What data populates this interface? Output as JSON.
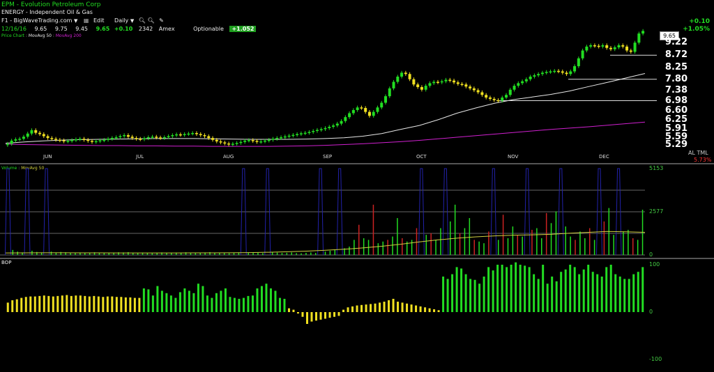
{
  "header": {
    "title": "EPM - Evolution Petroleum Corp",
    "sector": "ENERGY - Independent Oil & Gas",
    "window_label": "F1 - BigWaveTrading.com",
    "menu_edit": "Edit",
    "period": "Daily",
    "quote": {
      "date": "12/16/16",
      "open": "9.65",
      "high": "9.75",
      "low": "9.45",
      "close": "9.65",
      "change": "+0.10",
      "volume": "2342",
      "exchange": "Amex"
    },
    "optionable": "Optionable",
    "optionable_value": "+1.052",
    "change_abs": "+0.10",
    "change_pct": "+1.05%",
    "legend_price": "Price Chart",
    "legend_ma50": "MovAvg 50",
    "legend_ma200": "MovAvg 200"
  },
  "colors": {
    "up": "#22dd22",
    "down": "#f0e020",
    "ma50": "#e8e8e8",
    "ma200": "#d020d0",
    "volume_ma": "#d0d040",
    "volume_spike": "#2222aa",
    "red_volume": "#cc2222",
    "grid": "#666666"
  },
  "price_panel": {
    "last_price_tag": "9.65",
    "axis_labels": [
      "9.22",
      "8.72",
      "8.25",
      "7.80",
      "7.38",
      "6.98",
      "6.60",
      "6.25",
      "5.91",
      "5.59",
      "5.29"
    ],
    "months": [
      "JUN",
      "JUL",
      "AUG",
      "SEP",
      "OCT",
      "NOV",
      "DEC"
    ],
    "corner_tools": "AL TML",
    "corner_pct": "5.73%"
  },
  "volume_panel": {
    "title": "Volume",
    "ma_label": "MovAvg 50",
    "axis_labels": [
      "5153",
      "2577",
      "0"
    ]
  },
  "bop_panel": {
    "title": "BOP",
    "axis_labels": [
      "100",
      "0",
      "-100"
    ]
  },
  "chart_data": [
    {
      "type": "candlestick",
      "title": "EPM - Evolution Petroleum Corp",
      "x_months": [
        "JUN",
        "JUL",
        "AUG",
        "SEP",
        "OCT",
        "NOV",
        "DEC"
      ],
      "ylim": [
        5.1,
        9.5
      ],
      "y_ticks": [
        9.22,
        8.72,
        8.25,
        7.8,
        7.38,
        6.98,
        6.6,
        6.25,
        5.91,
        5.59,
        5.29
      ],
      "close": [
        5.33,
        5.45,
        5.5,
        5.52,
        5.6,
        5.72,
        5.85,
        5.75,
        5.7,
        5.62,
        5.55,
        5.52,
        5.48,
        5.46,
        5.42,
        5.44,
        5.47,
        5.5,
        5.52,
        5.48,
        5.44,
        5.4,
        5.43,
        5.46,
        5.48,
        5.52,
        5.55,
        5.58,
        5.62,
        5.66,
        5.6,
        5.55,
        5.52,
        5.5,
        5.54,
        5.58,
        5.6,
        5.57,
        5.55,
        5.58,
        5.62,
        5.66,
        5.69,
        5.67,
        5.7,
        5.72,
        5.74,
        5.7,
        5.66,
        5.62,
        5.55,
        5.48,
        5.42,
        5.38,
        5.34,
        5.3,
        5.33,
        5.36,
        5.4,
        5.45,
        5.47,
        5.44,
        5.4,
        5.42,
        5.45,
        5.48,
        5.52,
        5.55,
        5.58,
        5.61,
        5.64,
        5.67,
        5.7,
        5.73,
        5.75,
        5.78,
        5.82,
        5.86,
        5.89,
        5.93,
        5.98,
        6.03,
        6.1,
        6.2,
        6.35,
        6.5,
        6.62,
        6.72,
        6.7,
        6.55,
        6.4,
        6.55,
        6.72,
        6.9,
        7.15,
        7.45,
        7.7,
        7.9,
        8.05,
        8.0,
        7.8,
        7.6,
        7.5,
        7.4,
        7.55,
        7.65,
        7.7,
        7.68,
        7.72,
        7.78,
        7.75,
        7.68,
        7.62,
        7.6,
        7.52,
        7.45,
        7.38,
        7.3,
        7.2,
        7.1,
        7.05,
        7.0,
        6.98,
        7.1,
        7.2,
        7.4,
        7.55,
        7.65,
        7.72,
        7.8,
        7.9,
        7.95,
        8.0,
        8.05,
        8.08,
        8.1,
        8.12,
        8.1,
        8.05,
        8.0,
        8.1,
        8.3,
        8.6,
        8.9,
        9.05,
        9.1,
        9.08,
        9.05,
        9.1,
        9.0,
        8.95,
        9.02,
        9.1,
        9.05,
        8.9,
        8.85,
        9.2,
        9.55,
        9.65
      ]
    },
    {
      "type": "line",
      "name": "MovAvg 50",
      "values": [
        5.35,
        5.4,
        5.44,
        5.47,
        5.49,
        5.5,
        5.51,
        5.52,
        5.53,
        5.53,
        5.53,
        5.52,
        5.51,
        5.5,
        5.5,
        5.5,
        5.51,
        5.53,
        5.56,
        5.62,
        5.72,
        5.88,
        6.03,
        6.25,
        6.5,
        6.7,
        6.88,
        7.02,
        7.12,
        7.22,
        7.35,
        7.52,
        7.68,
        7.85,
        8.02
      ]
    },
    {
      "type": "line",
      "name": "MovAvg 200",
      "values": [
        5.32,
        5.3,
        5.29,
        5.28,
        5.27,
        5.26,
        5.26,
        5.25,
        5.25,
        5.24,
        5.24,
        5.23,
        5.23,
        5.23,
        5.23,
        5.24,
        5.25,
        5.27,
        5.3,
        5.33,
        5.37,
        5.41,
        5.46,
        5.52,
        5.58,
        5.64,
        5.7,
        5.76,
        5.82,
        5.88,
        5.93,
        5.98,
        6.04,
        6.1,
        6.16
      ]
    },
    {
      "type": "bar",
      "name": "Volume",
      "ylim": [
        0,
        5153
      ],
      "values": [
        5153,
        300,
        200,
        150,
        5153,
        250,
        180,
        150,
        5153,
        200,
        150,
        180,
        160,
        140,
        130,
        150,
        120,
        140,
        160,
        130,
        120,
        110,
        140,
        160,
        150,
        170,
        130,
        120,
        140,
        110,
        100,
        130,
        150,
        120,
        110,
        140,
        130,
        160,
        120,
        110,
        130,
        150,
        170,
        140,
        120,
        110,
        100,
        130,
        150,
        5153,
        140,
        120,
        130,
        110,
        5153,
        160,
        140,
        120,
        130,
        150,
        110,
        100,
        130,
        150,
        120,
        5153,
        200,
        250,
        300,
        5153,
        400,
        500,
        900,
        1800,
        1000,
        900,
        3000,
        700,
        800,
        900,
        1100,
        2200,
        1000,
        800,
        900,
        1600,
        5153,
        1200,
        1300,
        900,
        1600,
        5153,
        2000,
        3000,
        1300,
        1600,
        2200,
        900,
        800,
        700,
        1400,
        5153,
        900,
        2400,
        1000,
        1700,
        1200,
        1100,
        5153,
        1500,
        1600,
        1000,
        2500,
        1900,
        2600,
        5153,
        1700,
        1100,
        900,
        1400,
        1000,
        1600,
        900,
        5153,
        2000,
        2800,
        1200,
        5153,
        1400,
        1500,
        1000,
        900,
        2700
      ]
    },
    {
      "type": "bar",
      "name": "BOP",
      "ylim": [
        -100,
        100
      ],
      "values": [
        20,
        25,
        27,
        30,
        32,
        33,
        33,
        34,
        35,
        34,
        33,
        34,
        35,
        36,
        34,
        35,
        35,
        34,
        33,
        34,
        33,
        32,
        33,
        33,
        32,
        32,
        31,
        31,
        30,
        30,
        50,
        48,
        35,
        55,
        45,
        40,
        35,
        30,
        42,
        50,
        45,
        40,
        60,
        55,
        35,
        30,
        40,
        45,
        50,
        32,
        30,
        28,
        30,
        34,
        35,
        50,
        55,
        60,
        50,
        45,
        30,
        28,
        8,
        5,
        -3,
        -10,
        -25,
        -20,
        -18,
        -16,
        -14,
        -12,
        -10,
        -8,
        5,
        10,
        12,
        14,
        15,
        16,
        17,
        18,
        20,
        22,
        25,
        28,
        22,
        20,
        18,
        16,
        14,
        12,
        10,
        8,
        6,
        4,
        75,
        70,
        80,
        95,
        92,
        80,
        70,
        68,
        60,
        75,
        95,
        88,
        100,
        100,
        95,
        100,
        105,
        100,
        98,
        95,
        80,
        70,
        100,
        60,
        75,
        65,
        85,
        90,
        100,
        95,
        80,
        90,
        100,
        85,
        80,
        75,
        95,
        100,
        80,
        75,
        70,
        70,
        80,
        85,
        95
      ]
    }
  ]
}
